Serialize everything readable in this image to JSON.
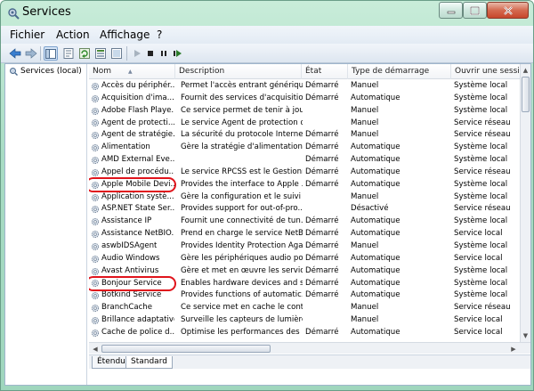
{
  "window": {
    "title": "Services",
    "title_icon": "gear-magnifier-icon",
    "colors": {
      "frame": "#a8dcc4",
      "highlight_circle": "#e0141c"
    }
  },
  "menu": [
    "Fichier",
    "Action",
    "Affichage",
    "?"
  ],
  "toolbar": {
    "buttons": [
      "back-arrow-icon",
      "forward-arrow-icon",
      "console-tree-icon",
      "properties-icon",
      "refresh-icon",
      "export-list-icon",
      "help-icon",
      "play-icon",
      "stop-icon",
      "pause-icon",
      "restart-icon"
    ]
  },
  "left_pane": {
    "label": "Services (local)"
  },
  "columns": {
    "name": "Nom",
    "description": "Description",
    "state": "État",
    "startup": "Type de démarrage",
    "account": "Ouvrir une session"
  },
  "rows": [
    {
      "name": "Accès du périphér...",
      "description": "Permet l'accès entrant générique...",
      "state": "Démarré",
      "startup": "Manuel",
      "account": "Système local"
    },
    {
      "name": "Acquisition d'ima...",
      "description": "Fournit des services d'acquisitio...",
      "state": "Démarré",
      "startup": "Automatique",
      "account": "Système local"
    },
    {
      "name": "Adobe Flash Playe...",
      "description": "Ce service permet de tenir à jour...",
      "state": "",
      "startup": "Manuel",
      "account": "Système local"
    },
    {
      "name": "Agent de protecti...",
      "description": "Le service Agent de protection d...",
      "state": "",
      "startup": "Manuel",
      "account": "Service réseau"
    },
    {
      "name": "Agent de stratégie...",
      "description": "La sécurité du protocole Interne...",
      "state": "Démarré",
      "startup": "Manuel",
      "account": "Service réseau"
    },
    {
      "name": "Alimentation",
      "description": "Gère la stratégie d'alimentation ...",
      "state": "Démarré",
      "startup": "Automatique",
      "account": "Système local"
    },
    {
      "name": "AMD External Eve...",
      "description": "",
      "state": "Démarré",
      "startup": "Automatique",
      "account": "Système local"
    },
    {
      "name": "Appel de procédu...",
      "description": "Le service RPCSS est le Gestionn...",
      "state": "Démarré",
      "startup": "Automatique",
      "account": "Service réseau"
    },
    {
      "name": "Apple Mobile Devi...",
      "description": "Provides the interface to Apple ...",
      "state": "Démarré",
      "startup": "Automatique",
      "account": "Système local"
    },
    {
      "name": "Application systè...",
      "description": "Gère la configuration et le suivi ...",
      "state": "",
      "startup": "Manuel",
      "account": "Système local"
    },
    {
      "name": "ASP.NET State Ser...",
      "description": "Provides support for out-of-pro...",
      "state": "",
      "startup": "Désactivé",
      "account": "Service réseau"
    },
    {
      "name": "Assistance IP",
      "description": "Fournit une connectivité de tun...",
      "state": "Démarré",
      "startup": "Automatique",
      "account": "Système local"
    },
    {
      "name": "Assistance NetBIO...",
      "description": "Prend en charge le service NetBI...",
      "state": "Démarré",
      "startup": "Automatique",
      "account": "Service local"
    },
    {
      "name": "aswbIDSAgent",
      "description": "Provides Identity Protection Aga...",
      "state": "Démarré",
      "startup": "Manuel",
      "account": "Système local"
    },
    {
      "name": "Audio Windows",
      "description": "Gère les périphériques audio po...",
      "state": "Démarré",
      "startup": "Automatique",
      "account": "Service local"
    },
    {
      "name": "Avast Antivirus",
      "description": "Gère et met en œuvre les service...",
      "state": "Démarré",
      "startup": "Automatique",
      "account": "Système local"
    },
    {
      "name": "Bonjour Service",
      "description": "Enables hardware devices and s...",
      "state": "Démarré",
      "startup": "Automatique",
      "account": "Système local"
    },
    {
      "name": "Botkind Service",
      "description": "Provides functions of automatic...",
      "state": "Démarré",
      "startup": "Automatique",
      "account": "Système local"
    },
    {
      "name": "BranchCache",
      "description": "Ce service met en cache le cont...",
      "state": "",
      "startup": "Manuel",
      "account": "Service réseau"
    },
    {
      "name": "Brillance adaptative",
      "description": "Surveille les capteurs de lumière...",
      "state": "",
      "startup": "Manuel",
      "account": "Service local"
    },
    {
      "name": "Cache de police d...",
      "description": "Optimise les performances des ...",
      "state": "Démarré",
      "startup": "Automatique",
      "account": "Service local"
    }
  ],
  "highlighted_rows": [
    "Apple Mobile Devi...",
    "Bonjour Service"
  ],
  "tabs": {
    "extended": "Étendu",
    "standard": "Standard",
    "active": "Standard"
  }
}
